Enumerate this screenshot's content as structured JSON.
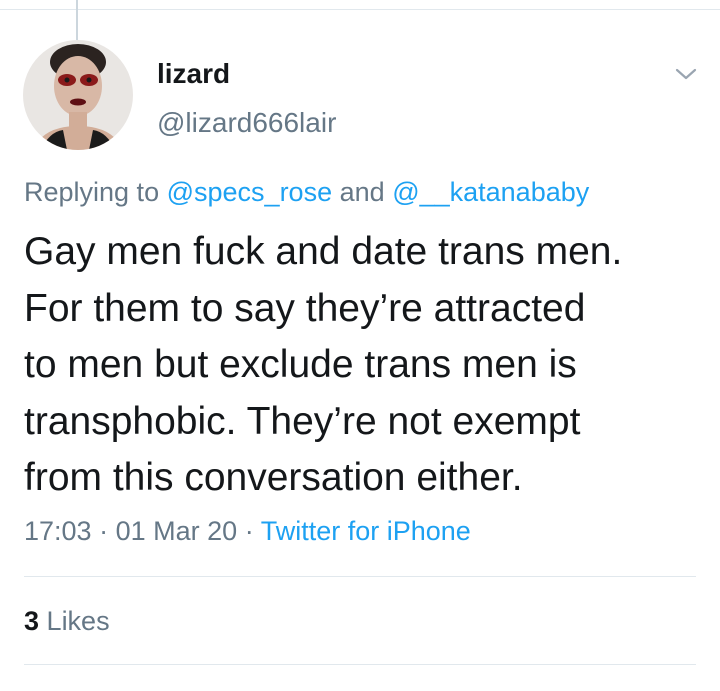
{
  "tweet": {
    "author": {
      "display_name": "lizard",
      "handle": "@lizard666lair",
      "avatar_icon": "user-avatar"
    },
    "reply_context": {
      "prefix": "Replying to",
      "mention_1": "@specs_rose",
      "joiner": "and",
      "mention_2": "@__katanababy"
    },
    "text": "Gay men fuck and date trans men.\nFor them to say they’re attracted\nto men but exclude trans men is\ntransphobic. They’re not exempt\nfrom this conversation either.",
    "time": "17:03",
    "separator": "·",
    "date": "01 Mar 20",
    "client": "Twitter for iPhone",
    "likes": {
      "count": "3",
      "label": "Likes"
    }
  },
  "colors": {
    "link": "#1da1f2",
    "secondary_text": "#657786",
    "primary_text": "#14171a",
    "divider": "#e1e8ed"
  }
}
